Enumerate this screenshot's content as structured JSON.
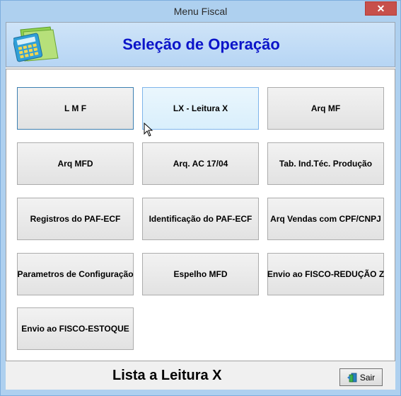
{
  "window": {
    "title": "Menu Fiscal",
    "close_label": "✕"
  },
  "header": {
    "title": "Seleção de Operação",
    "icon": "calculator-folder-icon"
  },
  "buttons": [
    {
      "label": "L M F"
    },
    {
      "label": "LX - Leitura X"
    },
    {
      "label": "Arq MF"
    },
    {
      "label": "Arq MFD"
    },
    {
      "label": "Arq. AC 17/04"
    },
    {
      "label": "Tab. Ind.Téc. Produção"
    },
    {
      "label": "Registros do PAF-ECF"
    },
    {
      "label": "Identificação do PAF-ECF"
    },
    {
      "label": "Arq Vendas com CPF/CNPJ"
    },
    {
      "label": "Parametros de Configuração"
    },
    {
      "label": "Espelho MFD"
    },
    {
      "label": "Envio ao FISCO-REDUÇÃO Z"
    },
    {
      "label": "Envio ao FISCO-ESTOQUE"
    }
  ],
  "footer": {
    "status_text": "Lista a Leitura X",
    "exit_label": "Sair",
    "exit_icon": "exit-door-icon"
  }
}
